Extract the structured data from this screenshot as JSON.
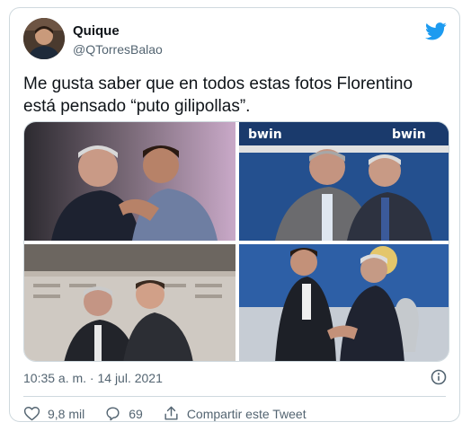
{
  "author": {
    "name": "Quique",
    "handle": "@QTorresBalao"
  },
  "tweet": {
    "text": "Me gusta saber que en todos estas fotos Florentino está pensado “puto gilipollas”."
  },
  "media": {
    "photos": [
      {
        "subject": "two men embracing at an event"
      },
      {
        "subject": "two men in suits in front of stadium sign",
        "signage": "bwin"
      },
      {
        "subject": "two men hugging in stadium box"
      },
      {
        "subject": "two men shaking hands with trophy in background"
      }
    ]
  },
  "meta": {
    "timestamp": "10:35 a. m. · 14 jul. 2021"
  },
  "actions": {
    "likes": "9,8 mil",
    "replies": "69",
    "share_label": "Compartir este Tweet"
  },
  "colors": {
    "brand": "#1d9bf0",
    "muted": "#536471",
    "border": "#cfd9de"
  },
  "icons": [
    "twitter-bird-icon",
    "info-icon",
    "heart-icon",
    "reply-icon",
    "share-icon"
  ]
}
